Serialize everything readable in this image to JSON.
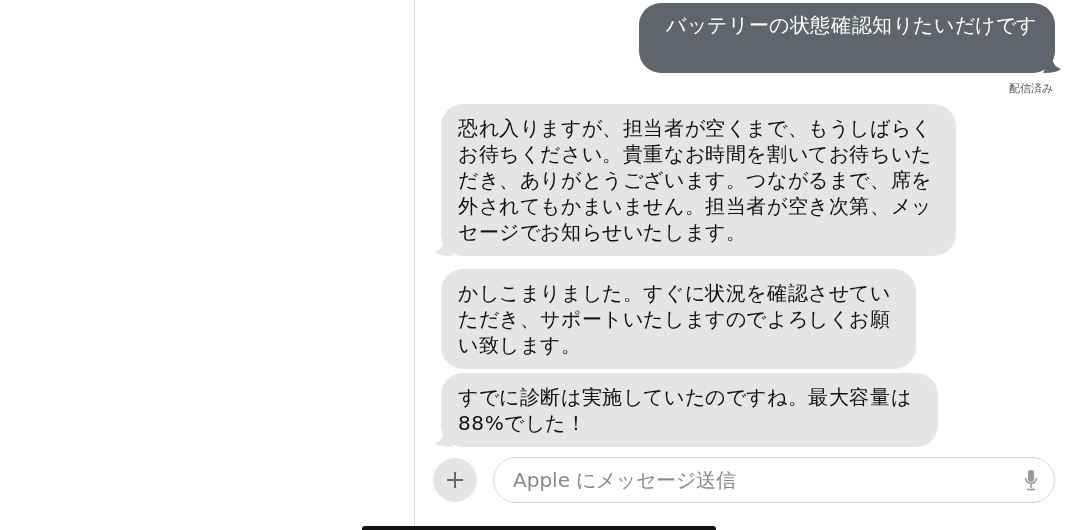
{
  "messages": [
    {
      "kind": "outgoing",
      "text": "バッテリーの状態確認知りたいだけです",
      "tail": true,
      "status": "配信済み"
    },
    {
      "kind": "incoming",
      "text": "恐れ入りますが、担当者が空くまで、もうしばらくお待ちください。貴重なお時間を割いてお待ちいただき、ありがとうございます。つながるまで、席を外されてもかまいません。担当者が空き次第、メッセージでお知らせいたします。",
      "tail": true
    },
    {
      "kind": "incoming",
      "text": "かしこまりました。すぐに状況を確認させていただき、サポートいたしますのでよろしくお願い致します。",
      "tail": false
    },
    {
      "kind": "incoming",
      "text": "すでに診断は実施していたのですね。最大容量は88%でした！",
      "tail": true
    }
  ],
  "composer": {
    "placeholder": "Apple にメッセージ送信"
  }
}
